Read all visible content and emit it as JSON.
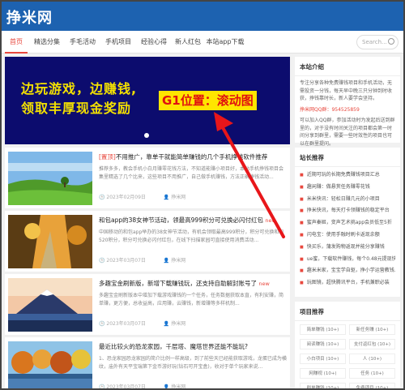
{
  "header": {
    "logo": "挣米网"
  },
  "nav": {
    "items": [
      {
        "label": "首页",
        "active": true
      },
      {
        "label": "精选分集",
        "active": false
      },
      {
        "label": "手毛活动",
        "active": false
      },
      {
        "label": "手机项目",
        "active": false
      },
      {
        "label": "经验心得",
        "active": false
      },
      {
        "label": "新人红包",
        "active": false
      },
      {
        "label": "本站app下载",
        "active": false
      }
    ],
    "search_placeholder": "Search..."
  },
  "banner": {
    "line1": "边玩游戏，边赚钱,",
    "line2": "领取丰厚现金奖励",
    "annotation": "G1位置：滚动图"
  },
  "articles": [
    {
      "tag": "[置顶]",
      "title": "不用推广，靠单干就能简单赚钱的几个手机挣钱软件推荐",
      "new": "",
      "excerpt": "推荐多多，教会手机小白月赚零花钱方法，不知道能赚小项目好，本站手机挣钱项目会集里精选了几个比来，这些项目不用推广，自己做手机赚钱，方法正确挣钱活动...",
      "date": "2023年02月09日",
      "author": "挣米网"
    },
    {
      "tag": "",
      "title": "和包app的38女神节活动，领最高999积分可兑换必闪付红包",
      "new": "new",
      "excerpt": "中国移动的和包app举办的38女神节活动，有机会领取最高999积分，积分可兑换和包520积分，积分可兑换必闪付红包，在线下扫描家园可直接使用消费活动...",
      "date": "2023年03月07日",
      "author": "挣米网"
    },
    {
      "tag": "",
      "title": "多趣宝金刷新版，新增下载赚钱玩，还支持自助解封账号了",
      "new": "new",
      "excerpt": "多趣宝金刷新版本中增加下载游戏赚钱的一个任务，任务数据获取本直，有利安赚，简单赚，更方便，总收益高，应用赚，云赚钱，新增赚等多样机制...",
      "date": "2023年03月07日",
      "author": "挣米网"
    },
    {
      "tag": "",
      "title": "最近比较火的恐龙家园，千层塔、魔塔世界还能不能玩?",
      "new": "",
      "excerpt": "1、恐龙家园恐龙家园的简介比例一样高级，到了前些天已经能获取游戏，龙蛋已成为横纹，庙外有天平宝瑞第下金币游好玩(钻石可开宝盒)，收对于单个玩家来说...",
      "date": "2023年03月07日",
      "author": "挣米网"
    }
  ],
  "sidebar": {
    "intro": {
      "title": "本站介绍",
      "text1": "专注分享各种免费赚钱项目和手机活动，无需投资一分钱，每天早中晚三只分钟到时收获，挣钱靠时长，新人要学会坚持。",
      "text2": "挣米网QQ群：954525859",
      "text3": "可以加入QQ群，参加活动时为发起后送到群里的，对于没有时间关注的项目都会第一时间分享到群里，需要一些时效性的项目也可以在群里提问。"
    },
    "recommend": {
      "title": "站长推荐",
      "items": [
        "近期可玩的长期免费赚钱项目汇总",
        "趣闲赚：做悬赏任务赚零花钱",
        "米米快讯：轻松日赚几元的小项目",
        "挣米快讯，每天打卡领赚钱的稳定平台",
        "蜜声秦姬，变声艺术挑app会员低至5折",
        "闪电宝：使用手融时刷卡返现余额",
        "快买乐，蒲发购物返现并能分享赚钱",
        "ue蜜，下载软件赚钱，每个0.48元提现快",
        "趣米米家，宝宝学自驱，挣小学运营教钱人",
        "玩图镜，超快腾讯平台，手机兼职必装"
      ]
    },
    "categories": {
      "title": "项目推荐",
      "tags": [
        "简单赚钱 (10+)",
        "新任务赚 (10+)",
        "阅读赚钱 (10+)",
        "支付返红包 (10+)",
        "小白项目 (10+)",
        "人 (10+)",
        "网赚视 (10+)",
        "任务 (10+)",
        "刷单赚钱 (10+)",
        "免费项目 (10+)"
      ]
    }
  },
  "colors": {
    "brand": "#1d62b0",
    "accent": "#e8483e",
    "banner_bg": "#0c0c6e",
    "banner_text": "#f4e100",
    "annotation_bg": "#ffe500",
    "annotation_text": "#e01010"
  }
}
